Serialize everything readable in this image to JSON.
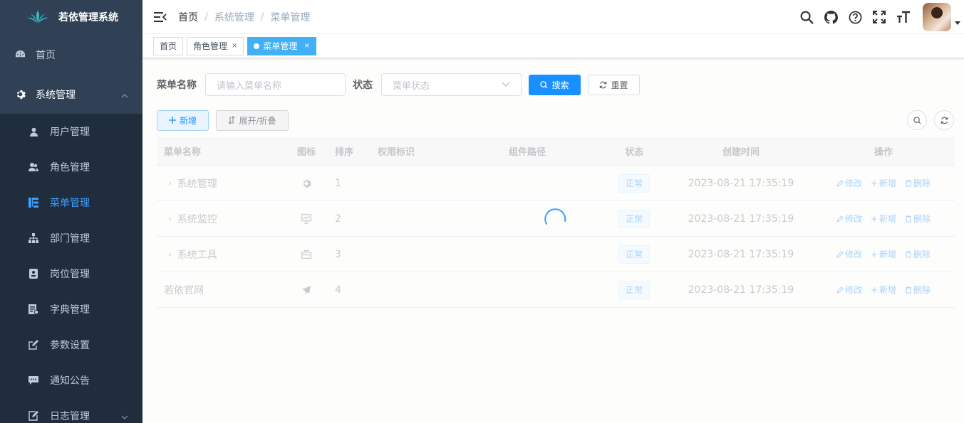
{
  "app_title": "若依管理系统",
  "sidebar": {
    "items": [
      {
        "label": "首页",
        "icon": "dashboard-icon"
      },
      {
        "label": "系统管理",
        "icon": "gear-icon",
        "expanded": true
      }
    ],
    "submenu": [
      {
        "label": "用户管理",
        "icon": "user-icon"
      },
      {
        "label": "角色管理",
        "icon": "peoples-icon"
      },
      {
        "label": "菜单管理",
        "icon": "tree-table-icon",
        "active": true
      },
      {
        "label": "部门管理",
        "icon": "tree-icon"
      },
      {
        "label": "岗位管理",
        "icon": "post-icon"
      },
      {
        "label": "字典管理",
        "icon": "dict-icon"
      },
      {
        "label": "参数设置",
        "icon": "edit-icon"
      },
      {
        "label": "通知公告",
        "icon": "message-icon"
      }
    ],
    "more": {
      "label": "日志管理",
      "icon": "log-icon"
    }
  },
  "breadcrumb": [
    "首页",
    "系统管理",
    "菜单管理"
  ],
  "tags": [
    {
      "label": "首页"
    },
    {
      "label": "角色管理",
      "close": "×"
    },
    {
      "label": "菜单管理",
      "close": "×",
      "active": true
    }
  ],
  "search": {
    "name_label": "菜单名称",
    "name_placeholder": "请输入菜单名称",
    "status_label": "状态",
    "status_placeholder": "菜单状态",
    "search_button": "搜索",
    "reset_button": "重置"
  },
  "toolbar": {
    "add_button": "新增",
    "toggle_button": "展开/折叠"
  },
  "table": {
    "columns": [
      "菜单名称",
      "图标",
      "排序",
      "权限标识",
      "组件路径",
      "状态",
      "创建时间",
      "操作"
    ],
    "rows": [
      {
        "name": "系统管理",
        "icon": "gear-icon",
        "order": "1",
        "perms": "",
        "component": "",
        "status": "正常",
        "created": "2023-08-21 17:35:19",
        "expandable": true
      },
      {
        "name": "系统监控",
        "icon": "monitor-icon",
        "order": "2",
        "perms": "",
        "component": "",
        "status": "正常",
        "created": "2023-08-21 17:35:19",
        "expandable": true
      },
      {
        "name": "系统工具",
        "icon": "tool-icon",
        "order": "3",
        "perms": "",
        "component": "",
        "status": "正常",
        "created": "2023-08-21 17:35:19",
        "expandable": true
      },
      {
        "name": "若依官网",
        "icon": "guide-icon",
        "order": "4",
        "perms": "",
        "component": "",
        "status": "正常",
        "created": "2023-08-21 17:35:19",
        "expandable": false
      }
    ],
    "ops": {
      "edit": "修改",
      "add": "新增",
      "delete": "删除"
    }
  },
  "colors": {
    "sidebar_bg": "#304156",
    "submenu_bg": "#1f2d3d",
    "primary": "#1890ff",
    "active_tag": "#42b0f5"
  }
}
